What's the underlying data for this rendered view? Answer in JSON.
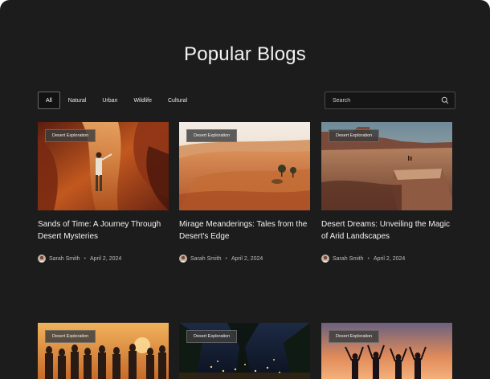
{
  "page": {
    "title": "Popular Blogs"
  },
  "filters": [
    "All",
    "Natural",
    "Urban",
    "Wildlife",
    "Cultural"
  ],
  "search": {
    "placeholder": "Search"
  },
  "cards": [
    {
      "tag": "Desert Exploration",
      "title": "Sands of Time: A Journey Through Desert Mysteries",
      "author": "Sarah Smith",
      "date": "April 2, 2024"
    },
    {
      "tag": "Desert Exploration",
      "title": "Mirage Meanderings: Tales from the Desert's Edge",
      "author": "Sarah Smith",
      "date": "April 2, 2024"
    },
    {
      "tag": "Desert Exploration",
      "title": "Desert Dreams: Unveiling the Magic of Arid Landscapes",
      "author": "Sarah Smith",
      "date": "April 2, 2024"
    },
    {
      "tag": "Desert Exploration"
    },
    {
      "tag": "Desert Exploration"
    },
    {
      "tag": "Desert Exploration"
    }
  ]
}
